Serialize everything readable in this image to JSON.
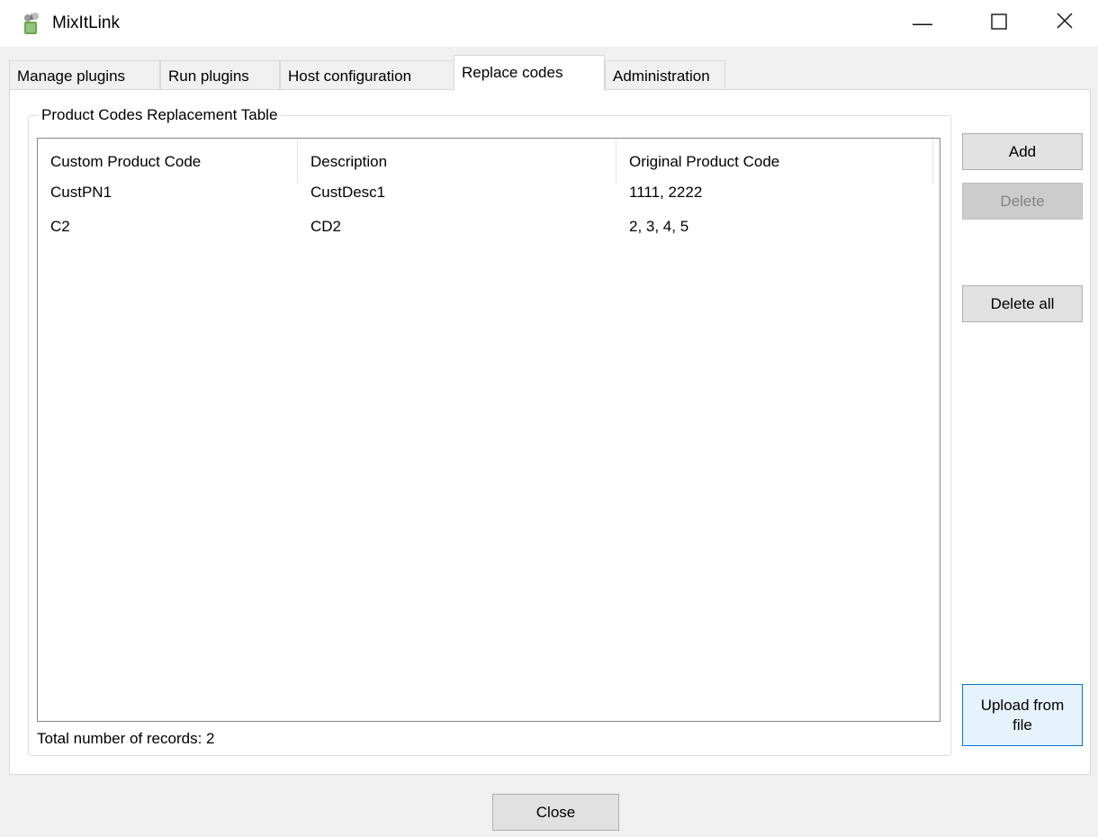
{
  "window": {
    "title": "MixItLink",
    "minimize_glyph": "—",
    "maximize_glyph": "☐",
    "close_glyph": "✕",
    "icon": "app-icon"
  },
  "tabs": [
    {
      "label": "Manage plugins"
    },
    {
      "label": "Run plugins"
    },
    {
      "label": "Host configuration"
    },
    {
      "label": "Replace codes"
    },
    {
      "label": "Administration"
    }
  ],
  "active_tab": "Replace codes",
  "group": {
    "title": "Product Codes Replacement Table"
  },
  "table": {
    "columns": [
      "Custom Product Code",
      "Description",
      "Original Product Code"
    ],
    "rows": [
      [
        "CustPN1",
        "CustDesc1",
        "1111, 2222"
      ],
      [
        "C2",
        "CD2",
        "2, 3, 4, 5"
      ]
    ]
  },
  "records_label": "Total number of records:  2",
  "buttons": {
    "add": "Add",
    "delete": "Delete",
    "delete_all": "Delete all",
    "upload_line1": "Upload  from",
    "upload_line2": "file",
    "close": "Close"
  }
}
